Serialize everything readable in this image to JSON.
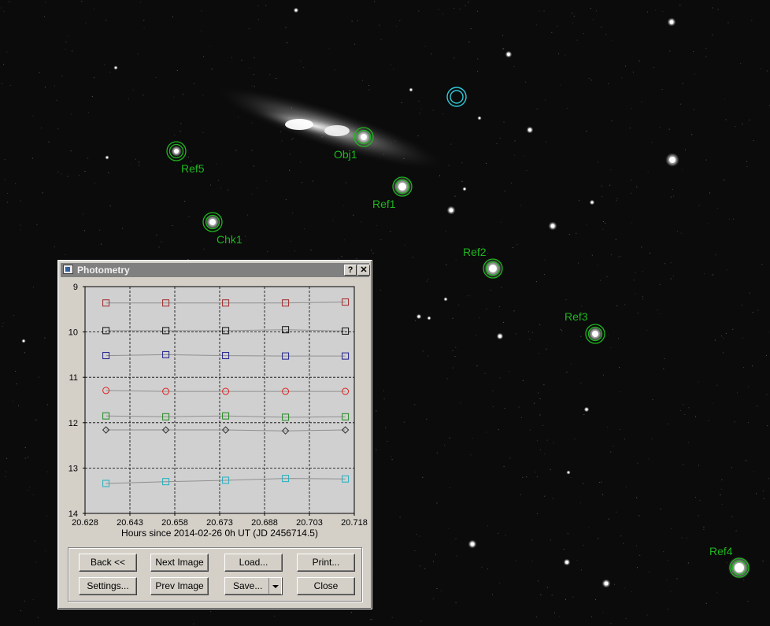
{
  "sky": {
    "labels": [
      {
        "id": "ref5",
        "text": "Ref5"
      },
      {
        "id": "obj1",
        "text": "Obj1"
      },
      {
        "id": "ref1",
        "text": "Ref1"
      },
      {
        "id": "chk1",
        "text": "Chk1"
      },
      {
        "id": "ref2",
        "text": "Ref2"
      },
      {
        "id": "ref3",
        "text": "Ref3"
      },
      {
        "id": "ref4",
        "text": "Ref4"
      }
    ],
    "marker_color": "#1fb51f",
    "selected_marker_color": "#2fc8d6"
  },
  "dialog": {
    "title": "Photometry",
    "help_btn": "?",
    "close_btn": "✕",
    "buttons": {
      "back": "Back <<",
      "next": "Next Image",
      "load": "Load...",
      "print": "Print...",
      "settings": "Settings...",
      "prev": "Prev Image",
      "save": "Save...",
      "close": "Close"
    }
  },
  "chart_data": {
    "type": "scatter",
    "xlabel": "Hours since 2014-02-26 0h UT (JD 2456714.5)",
    "ylabel": "",
    "xlim": [
      20.628,
      20.718
    ],
    "ylim": [
      9,
      14
    ],
    "y_inverted": true,
    "x_ticks": [
      "20.628",
      "20.643",
      "20.658",
      "20.673",
      "20.688",
      "20.703",
      "20.718"
    ],
    "y_ticks": [
      "9",
      "10",
      "11",
      "12",
      "13",
      "14"
    ],
    "grid": true,
    "x": [
      20.635,
      20.655,
      20.675,
      20.695,
      20.715
    ],
    "series": [
      {
        "marker": "square",
        "color": "#a02828",
        "values": [
          9.36,
          9.36,
          9.36,
          9.36,
          9.34
        ]
      },
      {
        "marker": "square",
        "color": "#101010",
        "values": [
          9.97,
          9.97,
          9.97,
          9.95,
          9.98
        ]
      },
      {
        "marker": "square",
        "color": "#20208c",
        "values": [
          10.52,
          10.5,
          10.52,
          10.53,
          10.53
        ]
      },
      {
        "marker": "circle",
        "color": "#e02020",
        "values": [
          11.29,
          11.31,
          11.31,
          11.31,
          11.31
        ]
      },
      {
        "marker": "square",
        "color": "#1f8a1f",
        "values": [
          11.85,
          11.87,
          11.85,
          11.88,
          11.87
        ]
      },
      {
        "marker": "diamond",
        "color": "#303030",
        "values": [
          12.16,
          12.16,
          12.16,
          12.18,
          12.16
        ]
      },
      {
        "marker": "square",
        "color": "#20b0c0",
        "values": [
          13.34,
          13.3,
          13.27,
          13.23,
          13.24
        ]
      }
    ]
  }
}
